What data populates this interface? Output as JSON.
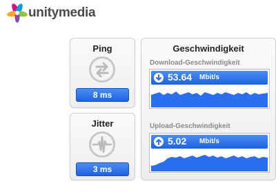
{
  "brand": {
    "name": "unitymedia",
    "logo_icon": "unitymedia-flower-logo",
    "colors": [
      "#e6007e",
      "#8cc63e",
      "#00a0df",
      "#f7a823"
    ]
  },
  "ping": {
    "title": "Ping",
    "icon": "swap-arrows-icon",
    "value": "8 ms"
  },
  "jitter": {
    "title": "Jitter",
    "icon": "waveform-icon",
    "value": "3 ms"
  },
  "speed": {
    "title": "Geschwindigkeit",
    "download": {
      "label": "Download-Geschwindigkeit",
      "icon": "download-arrow-icon",
      "value": "53.64",
      "unit": "Mbit/s"
    },
    "upload": {
      "label": "Upload-Geschwindigkeit",
      "icon": "upload-arrow-icon",
      "value": "5.02",
      "unit": "Mbit/s"
    }
  },
  "accent_color": "#2a6ff0"
}
